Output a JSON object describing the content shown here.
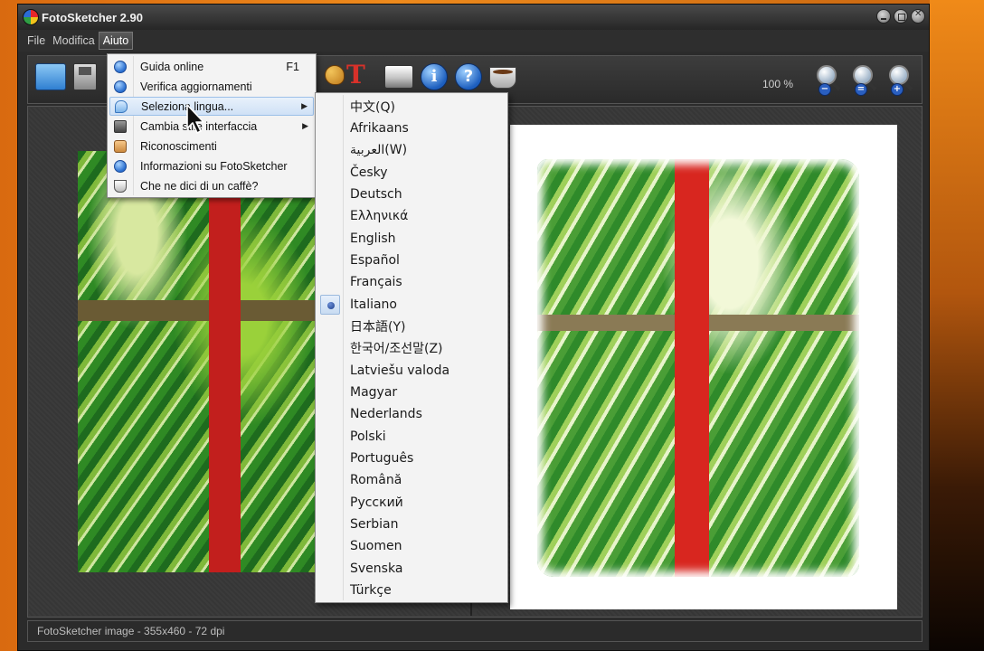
{
  "window": {
    "title": "FotoSketcher 2.90"
  },
  "menubar": {
    "items": [
      {
        "label": "File"
      },
      {
        "label": "Modifica"
      },
      {
        "label": "Aiuto"
      }
    ]
  },
  "toolbar": {
    "zoom_level": "100 %",
    "icons": [
      "open-folder-icon",
      "save-icon",
      "palette-icon",
      "text-icon",
      "print-icon",
      "info-icon",
      "help-icon",
      "coffee-icon",
      "zoom-out-icon",
      "zoom-fit-icon",
      "zoom-in-icon"
    ]
  },
  "help_menu": {
    "items": [
      {
        "label": "Guida online",
        "shortcut": "F1",
        "icon": "help-globe-icon"
      },
      {
        "label": "Verifica aggiornamenti",
        "icon": "globe-icon"
      },
      {
        "label": "Seleziona lingua...",
        "icon": "speech-bubble-icon",
        "submenu": true
      },
      {
        "label": "Cambia stile interfaccia",
        "icon": "window-style-icon",
        "submenu": true
      },
      {
        "label": "Riconoscimenti",
        "icon": "thumbs-up-icon"
      },
      {
        "label": "Informazioni su FotoSketcher",
        "icon": "info-icon"
      },
      {
        "label": "Che ne dici di un caffè?",
        "icon": "coffee-cup-icon"
      }
    ]
  },
  "language_menu": {
    "selected": "Italiano",
    "items": [
      "中文(Q)",
      "Afrikaans",
      "العربية(W)",
      "Česky",
      "Deutsch",
      "Ελληνικά",
      "English",
      "Español",
      "Français",
      "Italiano",
      "日本語(Y)",
      "한국어/조선말(Z)",
      "Latviešu valoda",
      "Magyar",
      "Nederlands",
      "Polski",
      "Português",
      "Română",
      "Русский",
      "Serbian",
      "Suomen",
      "Svenska",
      "Türkçe"
    ]
  },
  "statusbar": {
    "text": "FotoSketcher image - 355x460 - 72 dpi"
  },
  "colors": {
    "desktop": "#ee8a1c",
    "window_bg": "#2b2b2b",
    "menu_bg": "#f3f3f3",
    "menu_highlight": "#cfe1f6"
  }
}
